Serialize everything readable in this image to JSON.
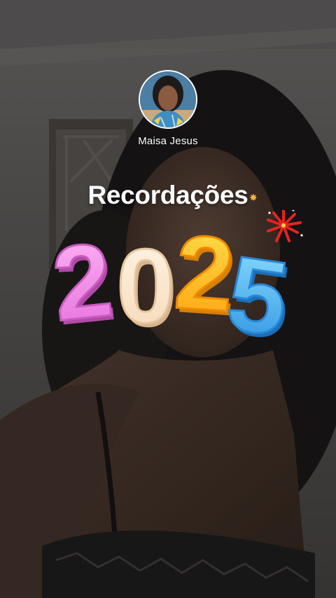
{
  "story": {
    "author_name": "Maisa Jesus",
    "avatar_icon": "profile-photo",
    "title": "Recordações",
    "year": "2025",
    "year_digits": [
      "2",
      "0",
      "2",
      "5"
    ],
    "colors": {
      "digit_1": "#f08ae6",
      "digit_2": "#ffe9c2",
      "digit_3": "#ffc21a",
      "digit_4": "#4fb6f0",
      "firework": "#e8231f",
      "sparkle": "#f1b23a"
    }
  }
}
